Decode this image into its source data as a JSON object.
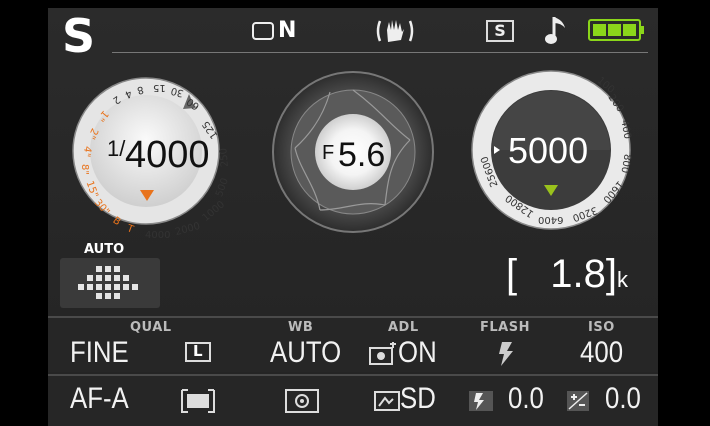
{
  "mode": "S",
  "status": {
    "image_area": "N",
    "music_icon": "music-note-icon",
    "battery": "full"
  },
  "shutter": {
    "prefix": "1/",
    "value": "4000",
    "scale_labels": [
      "4000",
      "2000",
      "1000",
      "500",
      "250",
      "125",
      "60",
      "30",
      "15",
      "8",
      "4",
      "2",
      "1\"",
      "2\"",
      "4\"",
      "8\"",
      "15\"",
      "30\"",
      "B",
      "T"
    ]
  },
  "aperture": {
    "prefix": "F",
    "value": "5.6"
  },
  "iso_dial": {
    "value": "5000",
    "scale_labels": [
      "100",
      "200",
      "400",
      "800",
      "1600",
      "3200",
      "6400",
      "12800",
      "25600"
    ]
  },
  "af_area": {
    "label": "AUTO"
  },
  "exposures": {
    "open": "[",
    "value": "1.8",
    "close": "]",
    "unit": "k"
  },
  "info_row_1": {
    "headers": {
      "qual": "QUAL",
      "wb": "WB",
      "adl": "ADL",
      "flash": "FLASH",
      "iso": "ISO"
    },
    "quality": "FINE",
    "size": "L",
    "wb": "AUTO",
    "adl": "ON",
    "iso": "400"
  },
  "info_row_2": {
    "focus_mode": "AF-A",
    "picture_control": "SD",
    "flash_comp": "0.0",
    "exposure_comp": "0.0"
  },
  "colors": {
    "accent_orange": "#e8731c",
    "accent_green": "#9ac21c",
    "battery_green": "#8bd61a"
  }
}
